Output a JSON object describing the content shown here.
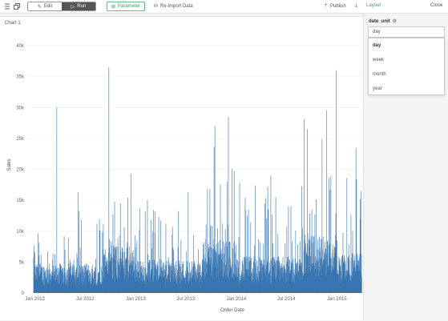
{
  "toolbar": {
    "edit_label": "Edit",
    "run_label": "Run",
    "parameter_label": "Parameter",
    "reimport_label": "Re-import Data",
    "publish_label": "Publish",
    "layout_label": "Layout",
    "close_label": "Close"
  },
  "chart_panel": {
    "title": "Chart 1"
  },
  "sidebar": {
    "param_name": "date_unit",
    "selected_value": "day",
    "options": [
      "day",
      "week",
      "month",
      "year"
    ]
  },
  "colors": {
    "bar": "#2f6fad",
    "accent_green": "#3a9a5e"
  },
  "chart_data": {
    "type": "bar",
    "xlabel": "Order Date",
    "ylabel": "Sales",
    "ylim": [
      0,
      40000
    ],
    "yticks": [
      0,
      5000,
      10000,
      15000,
      20000,
      25000,
      30000,
      35000,
      40000
    ],
    "ytick_labels": [
      "0",
      "5k",
      "10k",
      "15k",
      "20k",
      "25k",
      "30k",
      "35k",
      "40k"
    ],
    "xticks": [
      "2012-01-01",
      "2012-07-01",
      "2013-01-01",
      "2013-07-01",
      "2014-01-01",
      "2014-07-01",
      "2015-01-01"
    ],
    "xtick_labels": [
      "Jan 2012",
      "Jul 2012",
      "Jan 2013",
      "Jul 2013",
      "Jan 2014",
      "Jul 2014",
      "Jan 2015"
    ],
    "x_start": "2011-12-01",
    "x_end": "2015-03-31",
    "base_level": 3000,
    "peaks": [
      {
        "date": "2012-03-19",
        "value": 30000
      },
      {
        "date": "2012-09-24",
        "value": 36500
      },
      {
        "date": "2013-10-14",
        "value": 27000
      },
      {
        "date": "2013-12-02",
        "value": 28500
      },
      {
        "date": "2014-09-15",
        "value": 26500
      },
      {
        "date": "2014-11-24",
        "value": 29500
      },
      {
        "date": "2014-12-29",
        "value": 36000
      },
      {
        "date": "2015-03-10",
        "value": 23500
      }
    ],
    "series": [
      {
        "name": "Sales",
        "values": "daily sales values (procedurally approximated from the visible envelope)"
      }
    ]
  }
}
